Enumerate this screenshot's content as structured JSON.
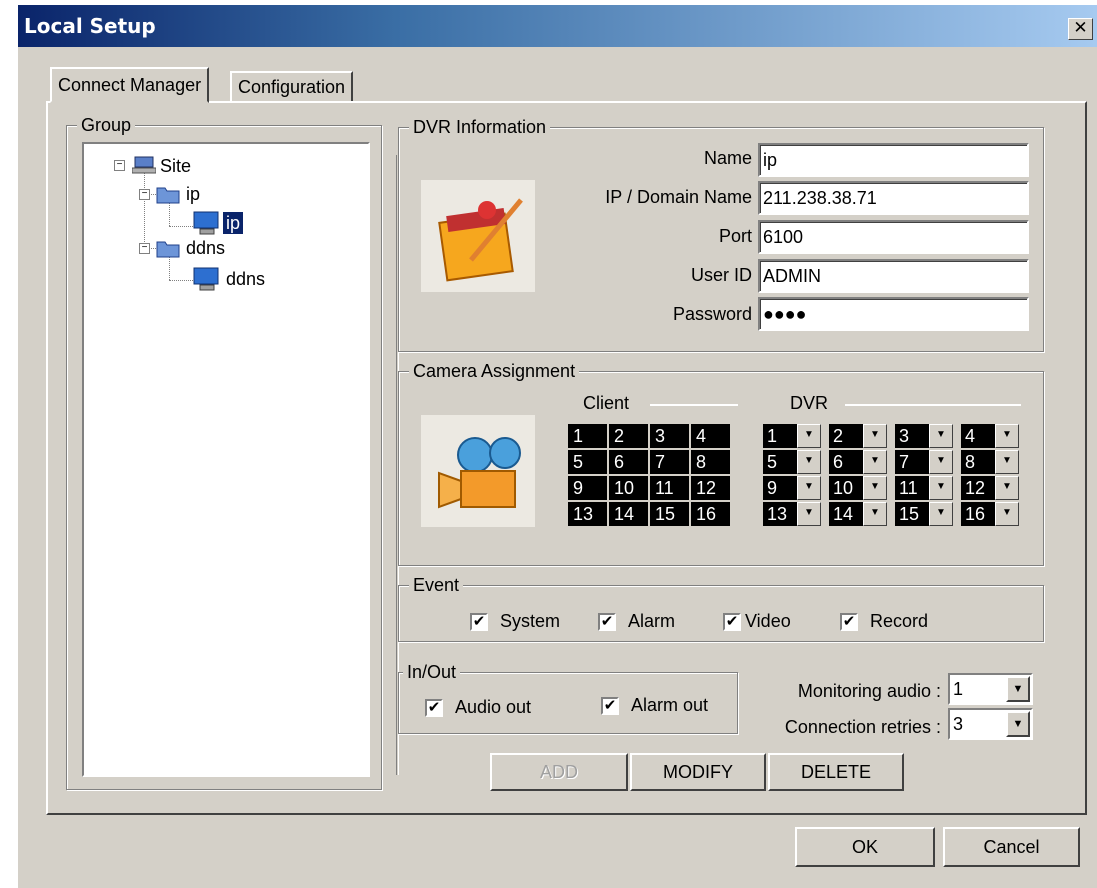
{
  "window": {
    "title": "Local Setup",
    "close_glyph": "✕"
  },
  "tabs": [
    {
      "label": "Connect Manager"
    },
    {
      "label": "Configuration"
    }
  ],
  "group": {
    "legend": "Group",
    "tree": {
      "site": "Site",
      "nodes": [
        {
          "label": "ip",
          "child": "ip"
        },
        {
          "label": "ddns",
          "child": "ddns"
        }
      ]
    }
  },
  "dvr_info": {
    "legend": "DVR Information",
    "name_label": "Name :",
    "name_value": "ip",
    "ip_label": "IP / Domain Name :",
    "ip_value": "211.238.38.71",
    "port_label": "Port :",
    "port_value": "6100",
    "userid_label": "User ID :",
    "userid_value": "ADMIN",
    "password_label": "Password :",
    "password_value": "●●●●"
  },
  "camera": {
    "legend": "Camera Assignment",
    "client_label": "Client",
    "dvr_label": "DVR",
    "client": [
      "1",
      "2",
      "3",
      "4",
      "5",
      "6",
      "7",
      "8",
      "9",
      "10",
      "11",
      "12",
      "13",
      "14",
      "15",
      "16"
    ],
    "dvr": [
      "1",
      "2",
      "3",
      "4",
      "5",
      "6",
      "7",
      "8",
      "9",
      "10",
      "11",
      "12",
      "13",
      "14",
      "15",
      "16"
    ]
  },
  "event": {
    "legend": "Event",
    "items": [
      {
        "label": "System",
        "checked": true
      },
      {
        "label": "Alarm",
        "checked": true
      },
      {
        "label": "Video",
        "checked": true
      },
      {
        "label": "Record",
        "checked": true
      }
    ]
  },
  "inout": {
    "legend": "In/Out",
    "audio_out": "Audio out",
    "alarm_out": "Alarm out"
  },
  "monitoring_audio": {
    "label": "Monitoring audio :",
    "value": "1"
  },
  "connection_retries": {
    "label": "Connection retries :",
    "value": "3"
  },
  "buttons": {
    "add": "ADD",
    "modify": "MODIFY",
    "delete": "DELETE",
    "ok": "OK",
    "cancel": "Cancel"
  },
  "check_glyph": "✔",
  "arrow_glyph": "▼"
}
